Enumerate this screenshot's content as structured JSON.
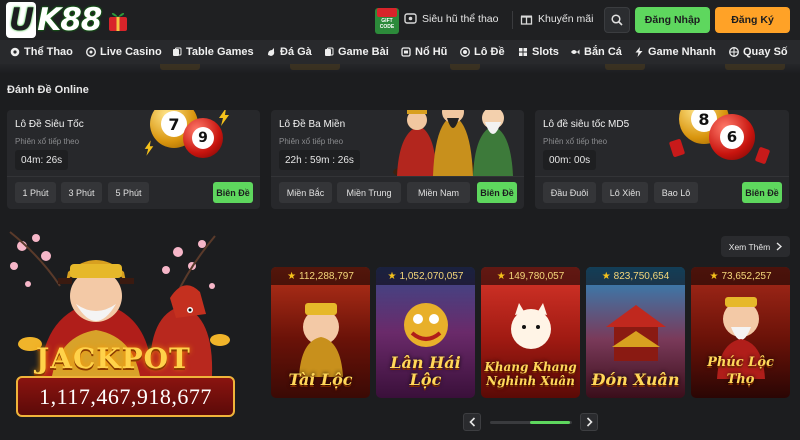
{
  "header": {
    "logo_letter": "U",
    "logo_rest": "K88",
    "gift_code_label": "GIFT CODE",
    "links": [
      "Siêu hũ thể thao",
      "Khuyến mãi"
    ],
    "login_label": "Đăng Nhập",
    "register_label": "Đăng Ký",
    "colors": {
      "login": "#5ed75e",
      "register": "#ffa227"
    }
  },
  "nav": {
    "items": [
      "Thể Thao",
      "Live Casino",
      "Table Games",
      "Đá Gà",
      "Game Bài",
      "Nổ Hũ",
      "Lô Đề",
      "Slots",
      "Bắn Cá",
      "Game Nhanh",
      "Quay Số"
    ],
    "icons": [
      "soccer-icon",
      "casino-chip-icon",
      "cards-icon",
      "rooster-icon",
      "cards-icon",
      "slot-icon",
      "lottery-icon",
      "slots-icon",
      "fish-icon",
      "bolt-icon",
      "wheel-icon"
    ]
  },
  "lottery": {
    "title": "Đánh Đề Online",
    "cards": [
      {
        "title": "Lô Đề Siêu Tốc",
        "subtitle": "Phiên xổ tiếp theo",
        "timer": "04m: 26s",
        "options": [
          "1 Phút",
          "3 Phút",
          "5 Phút"
        ],
        "action": "Biên Đề",
        "balls": [
          "7",
          "9"
        ]
      },
      {
        "title": "Lô Đề Ba Miền",
        "subtitle": "Phiên xổ tiếp theo",
        "timer": "22h : 59m : 26s",
        "options": [
          "Miền Bắc",
          "Miền Trung",
          "Miền Nam"
        ],
        "action": "Biên Đề"
      },
      {
        "title": "Lô đề siêu tốc MD5",
        "subtitle": "Phiên xổ tiếp theo",
        "timer": "00m: 00s",
        "options": [
          "Đầu Đuôi",
          "Lô Xiên",
          "Bao Lô"
        ],
        "action": "Biên Đề",
        "balls": [
          "8",
          "6"
        ]
      }
    ]
  },
  "jackpot": {
    "word": "JACKPOT",
    "amount": "1,117,467,918,677"
  },
  "games": {
    "see_more": "Xem Thêm",
    "items": [
      {
        "jackpot": "112,288,797",
        "title": "Tài Lộc"
      },
      {
        "jackpot": "1,052,070,057",
        "title": "Lân Hái Lộc"
      },
      {
        "jackpot": "149,780,057",
        "title": "Khang Khang Nghinh Xuân"
      },
      {
        "jackpot": "823,750,654",
        "title": "Đón Xuân"
      },
      {
        "jackpot": "73,652,257",
        "title": "Phúc Lộc Thọ"
      }
    ],
    "carousel_position": 0.5
  }
}
